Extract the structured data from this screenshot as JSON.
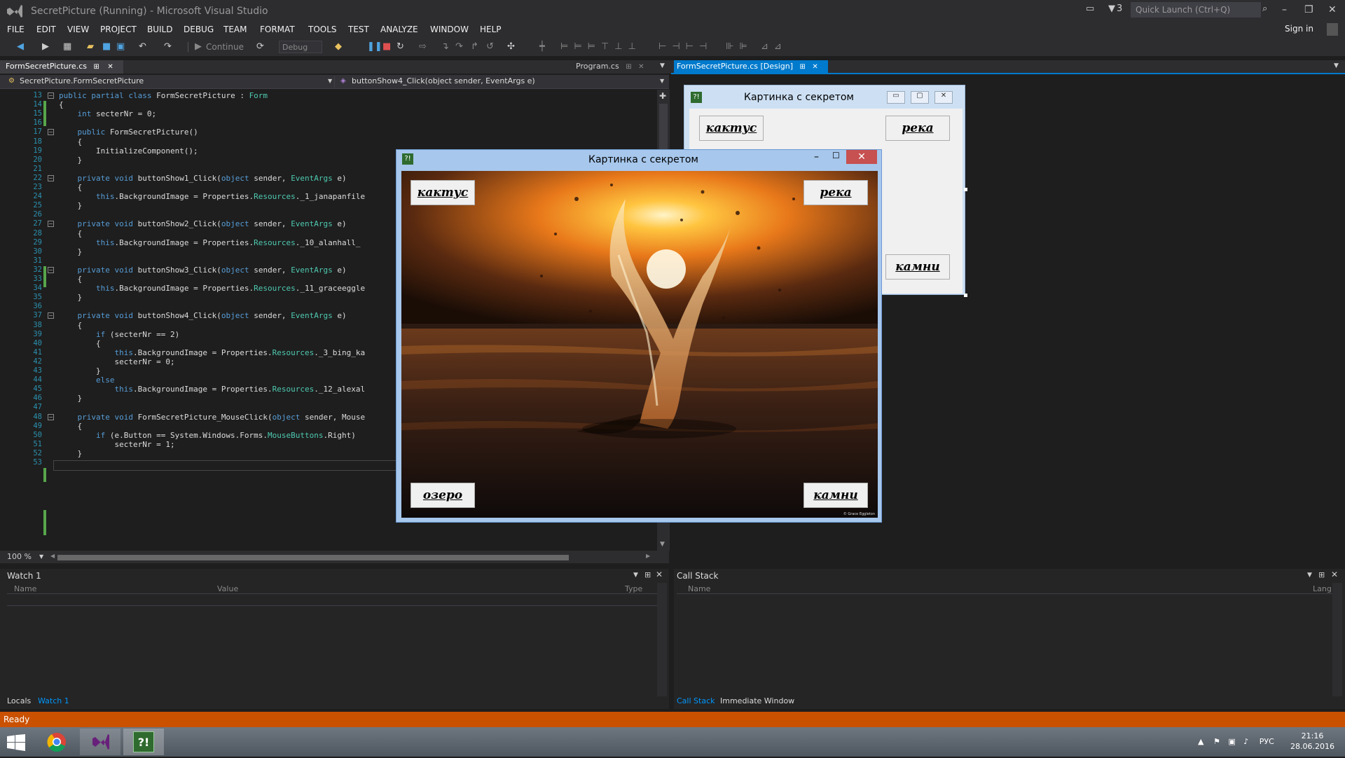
{
  "window": {
    "title": "SecretPicture (Running) - Microsoft Visual Studio",
    "notification_count": "3",
    "quick_launch_placeholder": "Quick Launch (Ctrl+Q)",
    "sign_in": "Sign in"
  },
  "menu": [
    "FILE",
    "EDIT",
    "VIEW",
    "PROJECT",
    "BUILD",
    "DEBUG",
    "TEAM",
    "FORMAT",
    "TOOLS",
    "TEST",
    "ANALYZE",
    "WINDOW",
    "HELP"
  ],
  "toolbar": {
    "continue_label": "Continue",
    "config": "Debug"
  },
  "tabs": {
    "code_tab": "FormSecretPicture.cs",
    "program_tab": "Program.cs",
    "design_tab": "FormSecretPicture.cs [Design]"
  },
  "nav": {
    "class_path": "SecretPicture.FormSecretPicture",
    "member": "buttonShow4_Click(object sender, EventArgs e)"
  },
  "code_lines": [
    {
      "n": "13",
      "t": "public partial class FormSecretPicture : Form"
    },
    {
      "n": "14",
      "t": "{"
    },
    {
      "n": "15",
      "t": "    int secterNr = 0;"
    },
    {
      "n": "16",
      "t": ""
    },
    {
      "n": "17",
      "t": "    public FormSecretPicture()"
    },
    {
      "n": "18",
      "t": "    {"
    },
    {
      "n": "19",
      "t": "        InitializeComponent();"
    },
    {
      "n": "20",
      "t": "    }"
    },
    {
      "n": "21",
      "t": ""
    },
    {
      "n": "22",
      "t": "    private void buttonShow1_Click(object sender, EventArgs e)"
    },
    {
      "n": "23",
      "t": "    {"
    },
    {
      "n": "24",
      "t": "        this.BackgroundImage = Properties.Resources._1_janapanfile"
    },
    {
      "n": "25",
      "t": "    }"
    },
    {
      "n": "26",
      "t": ""
    },
    {
      "n": "27",
      "t": "    private void buttonShow2_Click(object sender, EventArgs e)"
    },
    {
      "n": "28",
      "t": "    {"
    },
    {
      "n": "29",
      "t": "        this.BackgroundImage = Properties.Resources._10_alanhall_"
    },
    {
      "n": "30",
      "t": "    }"
    },
    {
      "n": "31",
      "t": ""
    },
    {
      "n": "32",
      "t": "    private void buttonShow3_Click(object sender, EventArgs e)"
    },
    {
      "n": "33",
      "t": "    {"
    },
    {
      "n": "34",
      "t": "        this.BackgroundImage = Properties.Resources._11_graceeggle"
    },
    {
      "n": "35",
      "t": "    }"
    },
    {
      "n": "36",
      "t": ""
    },
    {
      "n": "37",
      "t": "    private void buttonShow4_Click(object sender, EventArgs e)"
    },
    {
      "n": "38",
      "t": "    {"
    },
    {
      "n": "39",
      "t": "        if (secterNr == 2)"
    },
    {
      "n": "40",
      "t": "        {"
    },
    {
      "n": "41",
      "t": "            this.BackgroundImage = Properties.Resources._3_bing_ka"
    },
    {
      "n": "42",
      "t": "            secterNr = 0;"
    },
    {
      "n": "43",
      "t": "        }"
    },
    {
      "n": "44",
      "t": "        else"
    },
    {
      "n": "45",
      "t": "            this.BackgroundImage = Properties.Resources._12_alexal"
    },
    {
      "n": "46",
      "t": "    }"
    },
    {
      "n": "47",
      "t": ""
    },
    {
      "n": "48",
      "t": "    private void FormSecretPicture_MouseClick(object sender, Mouse"
    },
    {
      "n": "49",
      "t": "    {"
    },
    {
      "n": "50",
      "t": "        if (e.Button == System.Windows.Forms.MouseButtons.Right)"
    },
    {
      "n": "51",
      "t": "            secterNr = 1;"
    },
    {
      "n": "52",
      "t": "    }"
    },
    {
      "n": "53",
      "t": ""
    }
  ],
  "zoom": "100 %",
  "app_window": {
    "title": "Картинка с секретом",
    "btn_cactus": "кактус",
    "btn_river": "река",
    "btn_lake": "озеро",
    "btn_stones": "камни",
    "credit": "© Grace Eggleton"
  },
  "design_form": {
    "title": "Картинка с секретом",
    "btn_cactus": "кактус",
    "btn_river": "река",
    "btn_stones": "камни"
  },
  "watch": {
    "title": "Watch 1",
    "col_name": "Name",
    "col_value": "Value",
    "col_type": "Type",
    "tab_locals": "Locals",
    "tab_watch": "Watch 1"
  },
  "callstack": {
    "title": "Call Stack",
    "col_name": "Name",
    "col_lang": "Lang",
    "tab_callstack": "Call Stack",
    "tab_immediate": "Immediate Window"
  },
  "status": "Ready",
  "clock": {
    "time": "21:16",
    "date": "28.06.2016"
  },
  "tray_lang": "РУС"
}
